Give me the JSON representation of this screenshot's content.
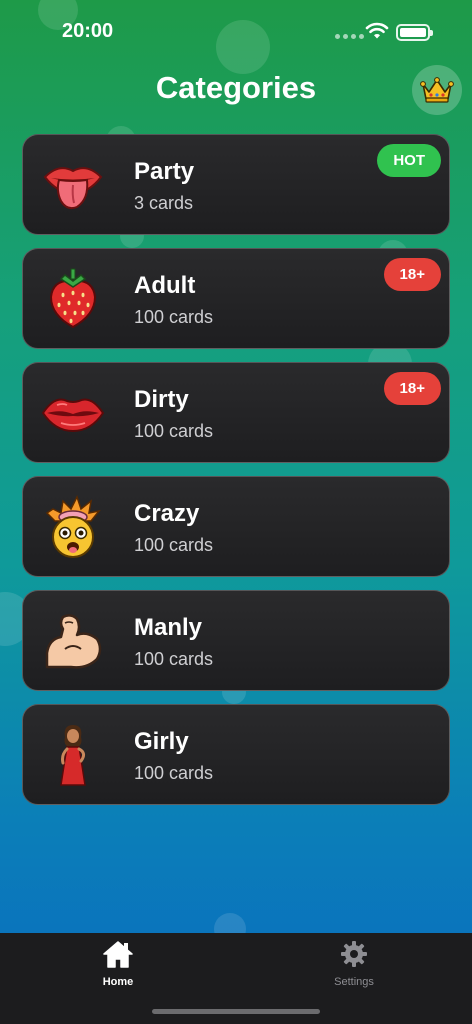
{
  "status_bar": {
    "time": "20:00"
  },
  "header": {
    "title": "Categories",
    "premium_icon": "crown-icon"
  },
  "categories": [
    {
      "name": "Party",
      "count": "3 cards",
      "badge": "HOT",
      "badge_color": "#30c24f",
      "icon": "tongue-lips-icon"
    },
    {
      "name": "Adult",
      "count": "100 cards",
      "badge": "18+",
      "badge_color": "#e5413a",
      "icon": "strawberry-icon"
    },
    {
      "name": "Dirty",
      "count": "100 cards",
      "badge": "18+",
      "badge_color": "#e5413a",
      "icon": "kiss-lips-icon"
    },
    {
      "name": "Crazy",
      "count": "100 cards",
      "icon": "exploding-head-icon"
    },
    {
      "name": "Manly",
      "count": "100 cards",
      "icon": "flexed-bicep-icon"
    },
    {
      "name": "Girly",
      "count": "100 cards",
      "icon": "woman-red-dress-icon"
    }
  ],
  "tab_bar": {
    "items": [
      {
        "label": "Home",
        "icon": "home-icon",
        "active": true,
        "color": "#ffffff"
      },
      {
        "label": "Settings",
        "icon": "gear-icon",
        "active": false,
        "color": "#8e8e93"
      }
    ]
  }
}
